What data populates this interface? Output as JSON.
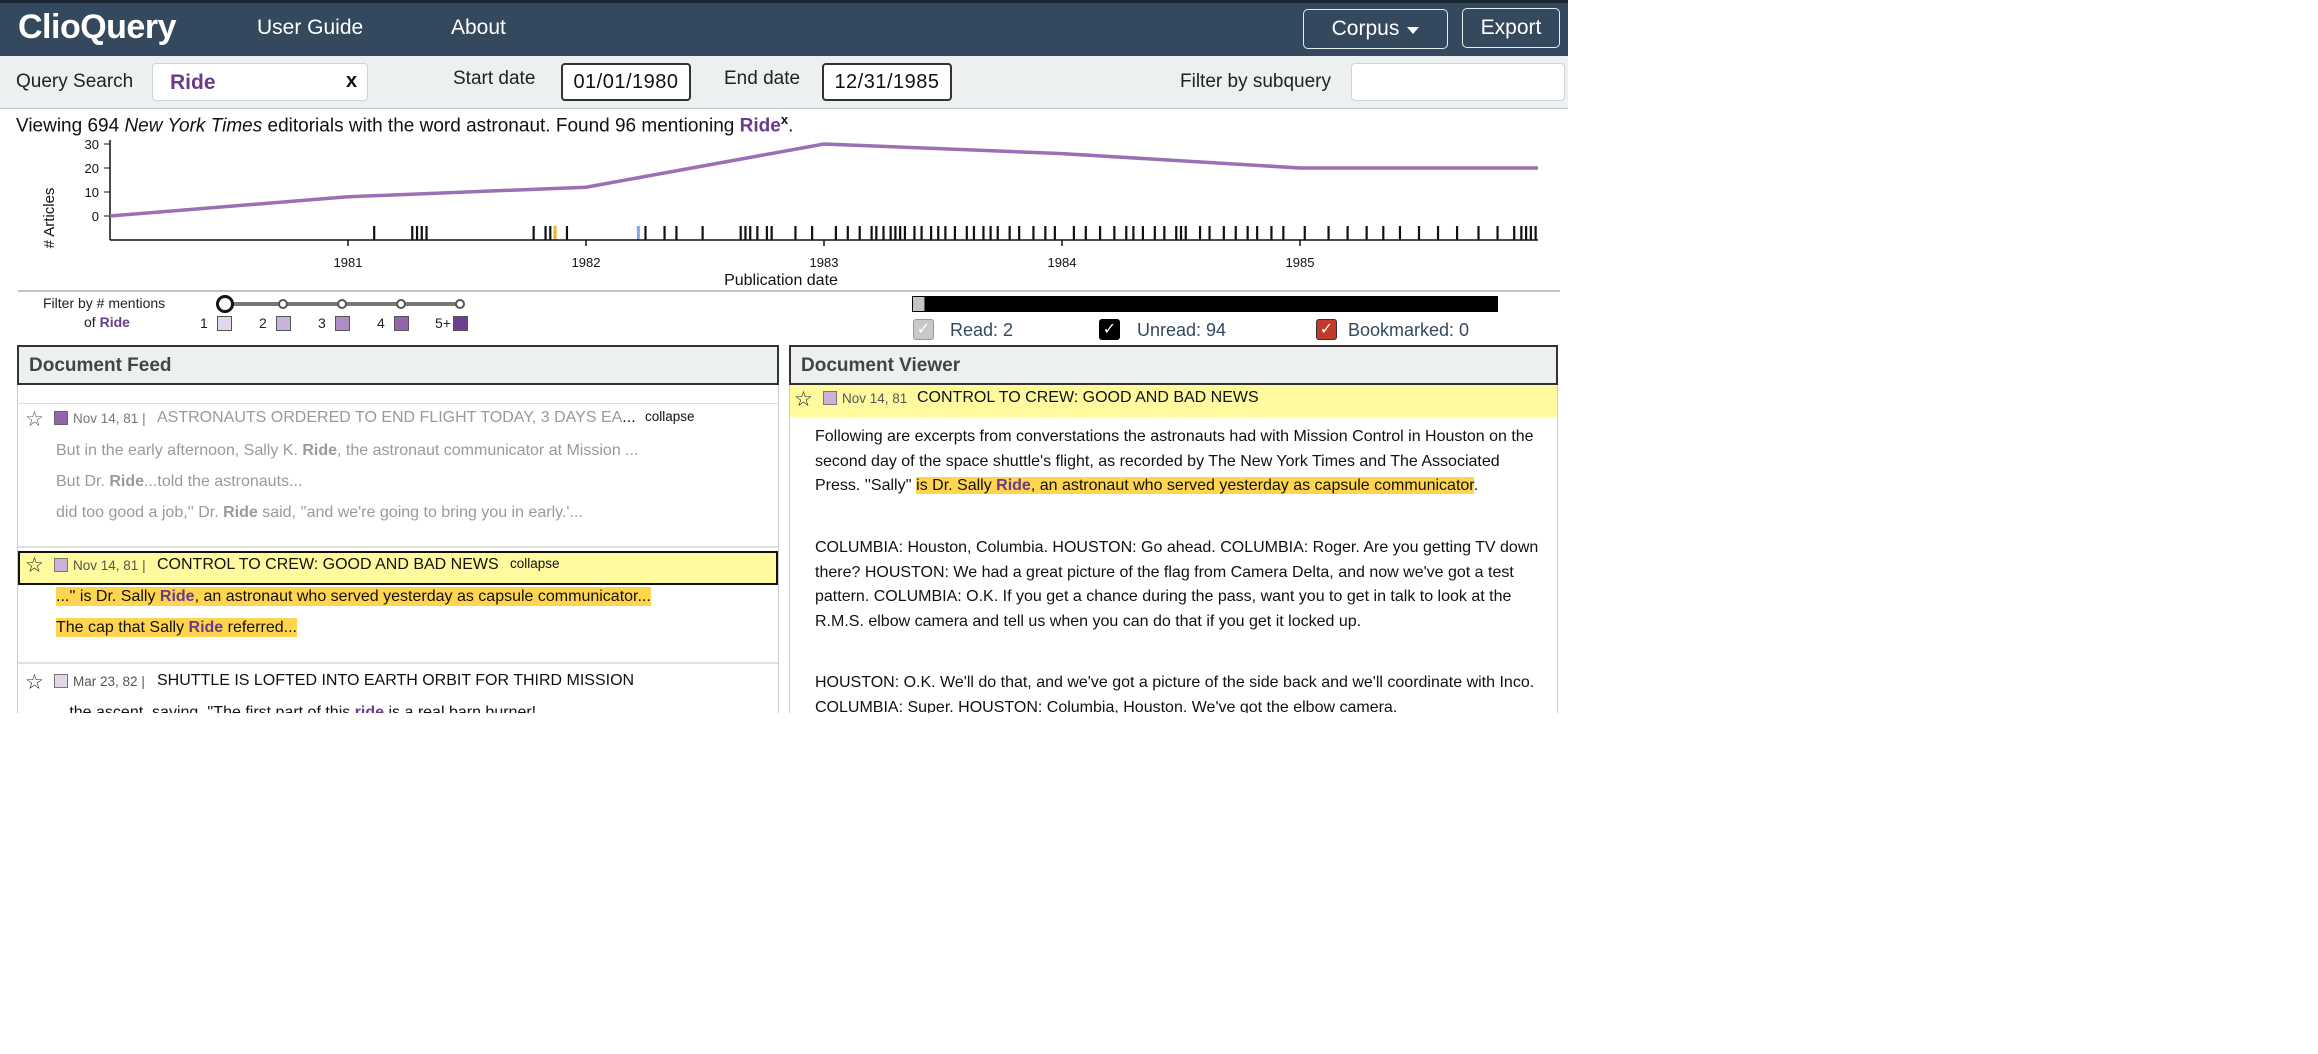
{
  "nav": {
    "brand": "ClioQuery",
    "links": [
      "User Guide",
      "About"
    ],
    "corpus_label": "Corpus",
    "export_label": "Export"
  },
  "search": {
    "query_label": "Query Search",
    "query_value": "Ride",
    "clear_glyph": "x",
    "start_label": "Start date",
    "start_value": "01/01/1980",
    "end_label": "End date",
    "end_value": "12/31/1985",
    "subquery_label": "Filter by subquery",
    "subquery_value": ""
  },
  "summary": {
    "prefix": "Viewing 694 ",
    "source": "New York Times",
    "middle": " editorials with the word astronaut.  Found 96 mentioning ",
    "keyword": "Ride",
    "remove_glyph": "x",
    "suffix": "."
  },
  "chart_data": {
    "type": "line",
    "ylabel": "# Articles",
    "xlabel": "Publication date",
    "yticks": [
      "30",
      "20",
      "10",
      "0"
    ],
    "xticks": [
      "1981",
      "1982",
      "1983",
      "1984",
      "1985"
    ],
    "x": [
      1980.0,
      1981.0,
      1982.0,
      1983.0,
      1984.0,
      1985.0,
      1986.0
    ],
    "values": [
      0,
      8,
      12,
      30,
      26,
      20,
      20
    ],
    "ylim": [
      0,
      30
    ],
    "line_color": "#9b6fb1",
    "rug_marks": [
      1981.11,
      1981.27,
      1981.29,
      1981.31,
      1981.33,
      1981.78,
      1981.83,
      1981.85,
      1981.92,
      1982.25,
      1982.33,
      1982.38,
      1982.49,
      1982.65,
      1982.67,
      1982.69,
      1982.72,
      1982.76,
      1982.78,
      1982.88,
      1982.95,
      1983.05,
      1983.1,
      1983.15,
      1983.2,
      1983.22,
      1983.25,
      1983.28,
      1983.3,
      1983.32,
      1983.34,
      1983.38,
      1983.41,
      1983.45,
      1983.48,
      1983.51,
      1983.55,
      1983.6,
      1983.63,
      1983.67,
      1983.7,
      1983.73,
      1983.78,
      1983.82,
      1983.88,
      1983.93,
      1983.97,
      1984.05,
      1984.1,
      1984.16,
      1984.22,
      1984.27,
      1984.3,
      1984.34,
      1984.39,
      1984.43,
      1984.48,
      1984.5,
      1984.52,
      1984.58,
      1984.62,
      1984.68,
      1984.73,
      1984.78,
      1984.82,
      1984.88,
      1984.93,
      1985.02,
      1985.12,
      1985.2,
      1985.28,
      1985.35,
      1985.42,
      1985.5,
      1985.58,
      1985.66,
      1985.75,
      1985.83,
      1985.9,
      1985.93,
      1985.95,
      1985.97,
      1985.99
    ],
    "rug_read": [
      {
        "x": 1981.87,
        "color": "#f0b429"
      },
      {
        "x": 1982.22,
        "color": "#7fa8e0"
      }
    ]
  },
  "filter": {
    "label_line1": "Filter by # mentions",
    "label_line2_prefix": "of ",
    "label_keyword": "Ride",
    "levels": [
      {
        "label": "1",
        "color": "#e2d6ea"
      },
      {
        "label": "2",
        "color": "#c9b3d8"
      },
      {
        "label": "3",
        "color": "#b08cc4"
      },
      {
        "label": "4",
        "color": "#9265ad"
      },
      {
        "label": "5+",
        "color": "#6e3f91"
      }
    ],
    "slider_position": 0
  },
  "status": {
    "progress_fraction": 0.02,
    "read_label": "Read: 2",
    "unread_label": "Unread: 94",
    "bookmarked_label": "Bookmarked: 0",
    "bookmark_color": "#c0392b"
  },
  "feed": {
    "title": "Document Feed",
    "items": [
      {
        "date": "Nov 14, 81",
        "sep": "|",
        "headline": "ASTRONAUTS ORDERED TO END FLIGHT TODAY, 3 DAYS EA",
        "ellipsis": "...",
        "toggle": "collapse",
        "snippets": [
          {
            "pre": "But in the early afternoon, Sally K. ",
            "kw": "Ride",
            "post": ", the astronaut communicator at Mission ..."
          },
          {
            "pre": "But Dr. ",
            "kw": "Ride",
            "post": "...told the astronauts..."
          },
          {
            "pre": "did too good a job,'' Dr. ",
            "kw": "Ride",
            "post": " said, ''and we're going to bring you in early.'..."
          }
        ]
      },
      {
        "date": "Nov 14, 81",
        "sep": "|",
        "headline": "CONTROL TO CREW: GOOD AND BAD NEWS",
        "toggle": "collapse",
        "snippets": [
          {
            "pre": "...'' is Dr. Sally ",
            "kw": "Ride",
            "post": ", an astronaut who served yesterday as capsule communicator..."
          },
          {
            "pre": "The cap that Sally ",
            "kw": "Ride",
            "post": " referred..."
          }
        ]
      },
      {
        "date": "Mar 23, 82",
        "sep": "|",
        "headline": "SHUTTLE IS LOFTED INTO EARTH ORBIT FOR THIRD MISSION",
        "snippets": [
          {
            "pre": "...the ascent, saying, ''The first part of this ",
            "kw": "ride",
            "post": " is a real barn burner!"
          }
        ]
      }
    ]
  },
  "viewer": {
    "title": "Document Viewer",
    "date": "Nov 14, 81",
    "headline": "CONTROL TO CREW: GOOD AND BAD NEWS",
    "p1_pre": "Following are excerpts from converstations the astronauts had with Mission Control in Houston on the second day of the space shuttle's flight, as recorded by The New York Times and The Associated Press. ''Sally'' ",
    "p1_hl_pre": "is Dr. Sally ",
    "p1_hl_kw": "Ride",
    "p1_hl_post": ", an astronaut who served yesterday as capsule communicator",
    "p1_post": ".",
    "p2": "COLUMBIA: Houston, Columbia. HOUSTON: Go ahead. COLUMBIA: Roger. Are you getting TV down there? HOUSTON: We had a great picture of the flag from Camera Delta, and now we've got a test pattern. COLUMBIA: O.K. If you get a chance during the pass, want you to get in talk to look at the R.M.S. elbow camera and tell us when you can do that if you get it locked up.",
    "p3": "HOUSTON: O.K. We'll do that, and we've got a picture of the side back and we'll coordinate with Inco. COLUMBIA: Super. HOUSTON: Columbia, Houston. We've got the elbow camera."
  }
}
